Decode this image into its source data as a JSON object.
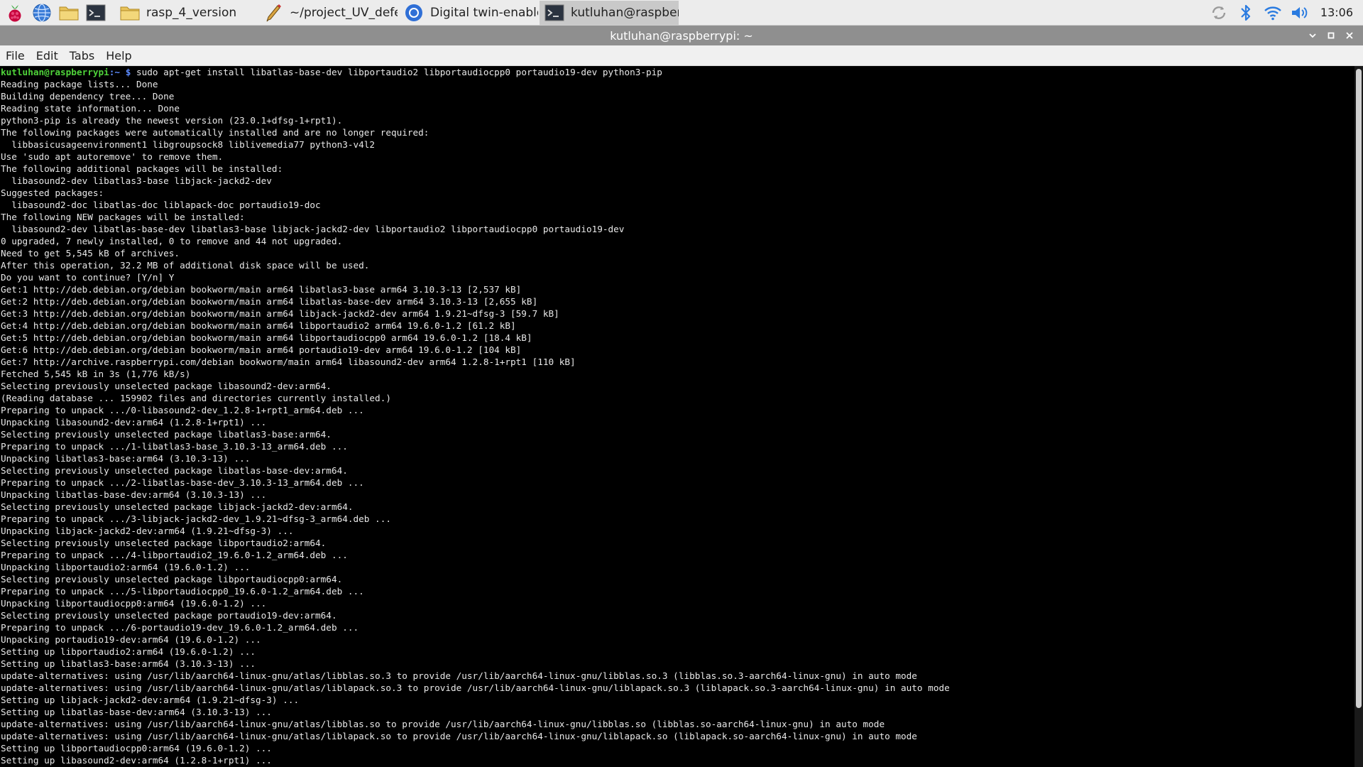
{
  "taskbar": {
    "launchers": [
      {
        "icon": "raspberry-menu-icon"
      },
      {
        "icon": "browser-globe-icon"
      },
      {
        "icon": "file-manager-icon"
      },
      {
        "icon": "terminal-icon"
      }
    ],
    "tasks": [
      {
        "label": "rasp_4_version",
        "icon": "folder-icon",
        "active": false
      },
      {
        "label": "~/project_UV_defect/..",
        "icon": "text-editor-icon",
        "active": false
      },
      {
        "label": "Digital twin-enabled ..",
        "icon": "chromium-icon",
        "active": false
      },
      {
        "label": "kutluhan@raspberry..",
        "icon": "terminal-icon",
        "active": true
      }
    ],
    "tray": {
      "icons": [
        "update-sync-icon",
        "bluetooth-icon",
        "wifi-icon",
        "volume-icon"
      ],
      "clock": "13:06"
    }
  },
  "window": {
    "title": "kutluhan@raspberrypi: ~",
    "menu": [
      "File",
      "Edit",
      "Tabs",
      "Help"
    ]
  },
  "terminal": {
    "prompt_user": "kutluhan@raspberrypi",
    "prompt_path": ":~ $",
    "command": " sudo apt-get install libatlas-base-dev libportaudio2 libportaudiocpp0 portaudio19-dev python3-pip",
    "output": [
      "Reading package lists... Done",
      "Building dependency tree... Done",
      "Reading state information... Done",
      "python3-pip is already the newest version (23.0.1+dfsg-1+rpt1).",
      "The following packages were automatically installed and are no longer required:",
      "  libbasicusageenvironment1 libgroupsock8 liblivemedia77 python3-v4l2",
      "Use 'sudo apt autoremove' to remove them.",
      "The following additional packages will be installed:",
      "  libasound2-dev libatlas3-base libjack-jackd2-dev",
      "Suggested packages:",
      "  libasound2-doc libatlas-doc liblapack-doc portaudio19-doc",
      "The following NEW packages will be installed:",
      "  libasound2-dev libatlas-base-dev libatlas3-base libjack-jackd2-dev libportaudio2 libportaudiocpp0 portaudio19-dev",
      "0 upgraded, 7 newly installed, 0 to remove and 44 not upgraded.",
      "Need to get 5,545 kB of archives.",
      "After this operation, 32.2 MB of additional disk space will be used.",
      "Do you want to continue? [Y/n] Y",
      "Get:1 http://deb.debian.org/debian bookworm/main arm64 libatlas3-base arm64 3.10.3-13 [2,537 kB]",
      "Get:2 http://deb.debian.org/debian bookworm/main arm64 libatlas-base-dev arm64 3.10.3-13 [2,655 kB]",
      "Get:3 http://deb.debian.org/debian bookworm/main arm64 libjack-jackd2-dev arm64 1.9.21~dfsg-3 [59.7 kB]",
      "Get:4 http://deb.debian.org/debian bookworm/main arm64 libportaudio2 arm64 19.6.0-1.2 [61.2 kB]",
      "Get:5 http://deb.debian.org/debian bookworm/main arm64 libportaudiocpp0 arm64 19.6.0-1.2 [18.4 kB]",
      "Get:6 http://deb.debian.org/debian bookworm/main arm64 portaudio19-dev arm64 19.6.0-1.2 [104 kB]",
      "Get:7 http://archive.raspberrypi.com/debian bookworm/main arm64 libasound2-dev arm64 1.2.8-1+rpt1 [110 kB]",
      "Fetched 5,545 kB in 3s (1,776 kB/s)",
      "Selecting previously unselected package libasound2-dev:arm64.",
      "(Reading database ... 159902 files and directories currently installed.)",
      "Preparing to unpack .../0-libasound2-dev_1.2.8-1+rpt1_arm64.deb ...",
      "Unpacking libasound2-dev:arm64 (1.2.8-1+rpt1) ...",
      "Selecting previously unselected package libatlas3-base:arm64.",
      "Preparing to unpack .../1-libatlas3-base_3.10.3-13_arm64.deb ...",
      "Unpacking libatlas3-base:arm64 (3.10.3-13) ...",
      "Selecting previously unselected package libatlas-base-dev:arm64.",
      "Preparing to unpack .../2-libatlas-base-dev_3.10.3-13_arm64.deb ...",
      "Unpacking libatlas-base-dev:arm64 (3.10.3-13) ...",
      "Selecting previously unselected package libjack-jackd2-dev:arm64.",
      "Preparing to unpack .../3-libjack-jackd2-dev_1.9.21~dfsg-3_arm64.deb ...",
      "Unpacking libjack-jackd2-dev:arm64 (1.9.21~dfsg-3) ...",
      "Selecting previously unselected package libportaudio2:arm64.",
      "Preparing to unpack .../4-libportaudio2_19.6.0-1.2_arm64.deb ...",
      "Unpacking libportaudio2:arm64 (19.6.0-1.2) ...",
      "Selecting previously unselected package libportaudiocpp0:arm64.",
      "Preparing to unpack .../5-libportaudiocpp0_19.6.0-1.2_arm64.deb ...",
      "Unpacking libportaudiocpp0:arm64 (19.6.0-1.2) ...",
      "Selecting previously unselected package portaudio19-dev:arm64.",
      "Preparing to unpack .../6-portaudio19-dev_19.6.0-1.2_arm64.deb ...",
      "Unpacking portaudio19-dev:arm64 (19.6.0-1.2) ...",
      "Setting up libportaudio2:arm64 (19.6.0-1.2) ...",
      "Setting up libatlas3-base:arm64 (3.10.3-13) ...",
      "update-alternatives: using /usr/lib/aarch64-linux-gnu/atlas/libblas.so.3 to provide /usr/lib/aarch64-linux-gnu/libblas.so.3 (libblas.so.3-aarch64-linux-gnu) in auto mode",
      "update-alternatives: using /usr/lib/aarch64-linux-gnu/atlas/liblapack.so.3 to provide /usr/lib/aarch64-linux-gnu/liblapack.so.3 (liblapack.so.3-aarch64-linux-gnu) in auto mode",
      "Setting up libjack-jackd2-dev:arm64 (1.9.21~dfsg-3) ...",
      "Setting up libatlas-base-dev:arm64 (3.10.3-13) ...",
      "update-alternatives: using /usr/lib/aarch64-linux-gnu/atlas/libblas.so to provide /usr/lib/aarch64-linux-gnu/libblas.so (libblas.so-aarch64-linux-gnu) in auto mode",
      "update-alternatives: using /usr/lib/aarch64-linux-gnu/atlas/liblapack.so to provide /usr/lib/aarch64-linux-gnu/liblapack.so (liblapack.so-aarch64-linux-gnu) in auto mode",
      "Setting up libportaudiocpp0:arm64 (19.6.0-1.2) ...",
      "Setting up libasound2-dev:arm64 (1.2.8-1+rpt1) ..."
    ]
  },
  "colors": {
    "prompt_user": "#4fd33a",
    "prompt_path": "#5d8cff",
    "terminal_bg": "#000000",
    "terminal_fg": "#e8e8e8",
    "titlebar_bg": "#8f8f8f",
    "taskbar_bg": "#ececec"
  }
}
